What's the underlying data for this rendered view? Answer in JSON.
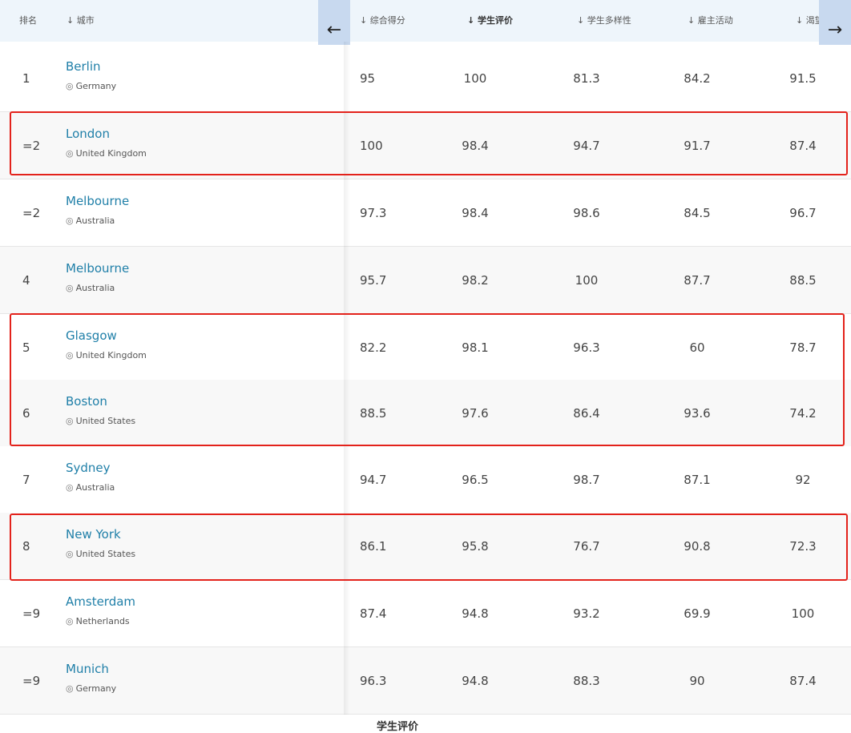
{
  "headers": {
    "rank": "排名",
    "city": "↓ 城市",
    "overall": "↓ 综合得分",
    "student_view": "↓ 学生评价",
    "diversity": "↓ 学生多样性",
    "employer": "↓ 雇主活动",
    "truncated": "↓ 渴望"
  },
  "nav": {
    "prev_arrow": "←",
    "next_arrow": "→"
  },
  "rows": [
    {
      "rank": "1",
      "city": "Berlin",
      "country": "Germany",
      "overall": "95",
      "student_view": "100",
      "diversity": "81.3",
      "employer": "84.2",
      "last": "91.5"
    },
    {
      "rank": "=2",
      "city": "London",
      "country": "United Kingdom",
      "overall": "100",
      "student_view": "98.4",
      "diversity": "94.7",
      "employer": "91.7",
      "last": "87.4"
    },
    {
      "rank": "=2",
      "city": "Melbourne",
      "country": "Australia",
      "overall": "97.3",
      "student_view": "98.4",
      "diversity": "98.6",
      "employer": "84.5",
      "last": "96.7"
    },
    {
      "rank": "4",
      "city": "Melbourne",
      "country": "Australia",
      "overall": "95.7",
      "student_view": "98.2",
      "diversity": "100",
      "employer": "87.7",
      "last": "88.5"
    },
    {
      "rank": "5",
      "city": "Glasgow",
      "country": "United Kingdom",
      "overall": "82.2",
      "student_view": "98.1",
      "diversity": "96.3",
      "employer": "60",
      "last": "78.7"
    },
    {
      "rank": "6",
      "city": "Boston",
      "country": "United States",
      "overall": "88.5",
      "student_view": "97.6",
      "diversity": "86.4",
      "employer": "93.6",
      "last": "74.2"
    },
    {
      "rank": "7",
      "city": "Sydney",
      "country": "Australia",
      "overall": "94.7",
      "student_view": "96.5",
      "diversity": "98.7",
      "employer": "87.1",
      "last": "92"
    },
    {
      "rank": "8",
      "city": "New York",
      "country": "United States",
      "overall": "86.1",
      "student_view": "95.8",
      "diversity": "76.7",
      "employer": "90.8",
      "last": "72.3"
    },
    {
      "rank": "=9",
      "city": "Amsterdam",
      "country": "Netherlands",
      "overall": "87.4",
      "student_view": "94.8",
      "diversity": "93.2",
      "employer": "69.9",
      "last": "100"
    },
    {
      "rank": "=9",
      "city": "Munich",
      "country": "Germany",
      "overall": "96.3",
      "student_view": "94.8",
      "diversity": "88.3",
      "employer": "90",
      "last": "87.4"
    }
  ],
  "footer_text": "学生评价",
  "colors": {
    "highlight": "#e3221b",
    "city_link": "#1f7fa8",
    "header_bg": "#eef5fb",
    "arrow_bg": "#c8d9ef"
  }
}
